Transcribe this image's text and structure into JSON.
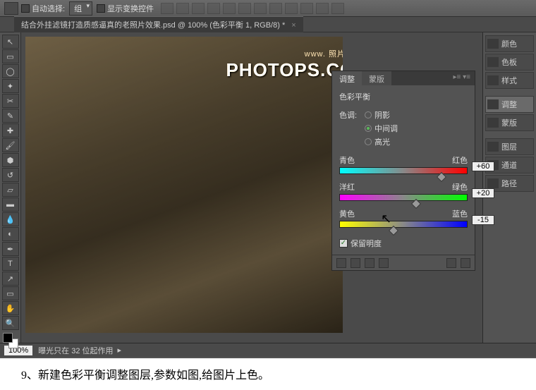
{
  "toolbar": {
    "auto_select": "自动选择:",
    "group": "组",
    "show_transform": "显示变换控件"
  },
  "doc_tab": "结合外挂滤镜打造质感逼真的老照片效果.psd @ 100% (色彩平衡 1, RGB/8) *",
  "watermark": {
    "line1": "www.   照片处理网",
    "line2": "PHOTOPS.COM"
  },
  "adj": {
    "tab1": "调整",
    "tab2": "蒙版",
    "title": "色彩平衡",
    "tone_label": "色调:",
    "shadows": "阴影",
    "midtones": "中间调",
    "highlights": "高光",
    "cyan": "青色",
    "red": "红色",
    "val_cr": "+60",
    "magenta": "洋红",
    "green": "绿色",
    "val_mg": "+20",
    "yellow": "黄色",
    "blue": "蓝色",
    "val_yb": "-15",
    "preserve": "保留明度"
  },
  "right": {
    "color": "颜色",
    "swatches": "色板",
    "styles": "样式",
    "adjust": "调整",
    "mask": "蒙版",
    "layers": "图层",
    "channels": "通道",
    "paths": "路径"
  },
  "status": {
    "zoom": "100%",
    "exposure": "曝光只在 32 位起作用"
  },
  "caption": "9、新建色彩平衡调整图层,参数如图,给图片上色。"
}
